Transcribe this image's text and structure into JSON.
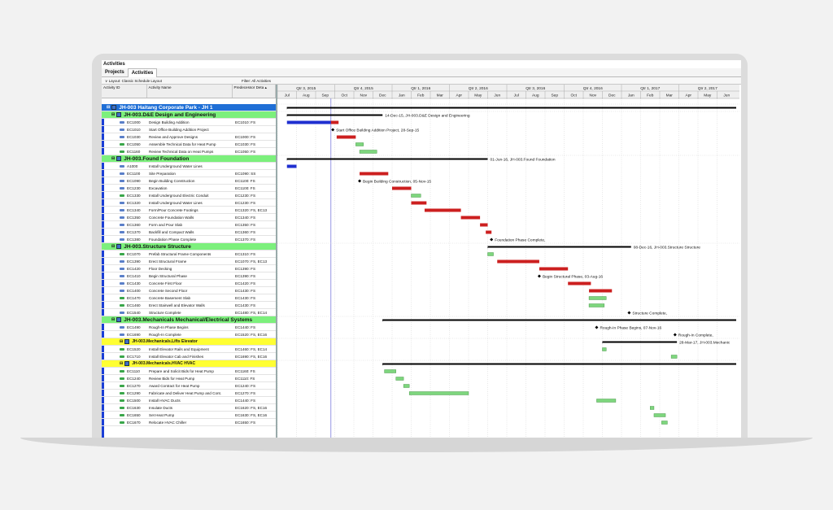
{
  "window": {
    "title": "Activities"
  },
  "tabs": [
    {
      "label": "Projects"
    },
    {
      "label": "Activities"
    }
  ],
  "toolbar": {
    "layout": "Layout: Classic Schedule Layout",
    "filter": "Filter: All Activities"
  },
  "columns": {
    "id": "Activity ID",
    "name": "Activity Name",
    "pred": "Predecessor Deta"
  },
  "timescale": {
    "quarters": [
      "Qtr 3, 2015",
      "Qtr 4, 2015",
      "Qtr 1, 2016",
      "Qtr 2, 2016",
      "Qtr 3, 2016",
      "Qtr 4, 2016",
      "Qtr 1, 2017",
      "Qtr 2, 2017"
    ],
    "months": [
      "Jul",
      "Aug",
      "Sep",
      "Oct",
      "Nov",
      "Dec",
      "Jan",
      "Feb",
      "Mar",
      "Apr",
      "May",
      "Jun",
      "Jul",
      "Aug",
      "Sep",
      "Oct",
      "Nov",
      "Dec",
      "Jan",
      "Feb",
      "Mar",
      "Apr",
      "May",
      "Jun"
    ]
  },
  "colors": {
    "wbs_project": "#1f6fd6",
    "wbs_green": "#7cf07c",
    "wbs_yellow": "#ffff33",
    "critical": "#cc1f1f",
    "normal": "#7ed67e",
    "progress": "#1f2fd0",
    "summary": "#000000"
  },
  "rows": [
    {
      "kind": "project",
      "name": "JH-003  Haitang Corporate Park - JH 1",
      "bar": {
        "type": "summary",
        "start": 0.5,
        "end": 24
      }
    },
    {
      "kind": "wbs",
      "color": "green",
      "name": "JH-003.D&E  Design and Engineering",
      "bar": {
        "type": "summary",
        "start": 0.5,
        "end": 5.5
      },
      "label": "14-Dec-15, JH-003.D&E  Design and Engineering"
    },
    {
      "kind": "act",
      "id": "EC1000",
      "name": "Design Building Addition",
      "pred": "EC1010: FS",
      "bar": {
        "type": "progress",
        "start": 0.5,
        "end": 2.8
      },
      "bar2": {
        "type": "critical",
        "start": 2.8,
        "end": 3.2
      }
    },
    {
      "kind": "act",
      "id": "EC1010",
      "name": "Start Office Building Addition Project",
      "pred": "",
      "bar": {
        "type": "milestone",
        "start": 2.9
      },
      "label": "Start Office Building Addition Project, 28-Sep-15"
    },
    {
      "kind": "act",
      "id": "EC1030",
      "name": "Review and Approve Designs",
      "pred": "EC1000: FS",
      "bar": {
        "type": "critical",
        "start": 3.1,
        "end": 4.1
      }
    },
    {
      "kind": "act",
      "id": "EC1050",
      "name": "Assemble Technical Data for Heat Pump",
      "pred": "EC1030: FS",
      "bar": {
        "type": "normal",
        "start": 4.1,
        "end": 4.5
      }
    },
    {
      "kind": "act",
      "id": "EC1160",
      "name": "Review Technical Data on Heat Pumps",
      "pred": "EC1050: FS",
      "bar": {
        "type": "normal",
        "start": 4.3,
        "end": 5.2
      }
    },
    {
      "kind": "wbs",
      "color": "green",
      "name": "JH-003.Found  Foundation",
      "bar": {
        "type": "summary",
        "start": 0.5,
        "end": 11.0
      },
      "label": "01-Jun-16, JH-003.Found  Foundation"
    },
    {
      "kind": "act",
      "id": "A1000",
      "name": "Install Underground Water Lines",
      "pred": "",
      "bar": {
        "type": "progress",
        "start": 0.5,
        "end": 1.0
      }
    },
    {
      "kind": "act",
      "id": "EC1100",
      "name": "Site Preparation",
      "pred": "EC1090: SS",
      "bar": {
        "type": "critical",
        "start": 4.3,
        "end": 5.8
      }
    },
    {
      "kind": "act",
      "id": "EC1090",
      "name": "Begin Building Construction",
      "pred": "EC1100: FS",
      "bar": {
        "type": "milestone",
        "start": 4.3
      },
      "label": "Begin Building Construction, 05-Nov-15"
    },
    {
      "kind": "act",
      "id": "EC1230",
      "name": "Excavation",
      "pred": "EC1100: FS",
      "bar": {
        "type": "critical",
        "start": 6.0,
        "end": 7.0
      }
    },
    {
      "kind": "act",
      "id": "EC1330",
      "name": "Install Underground Electric Conduit",
      "pred": "EC1230: FS",
      "bar": {
        "type": "normal",
        "start": 7.0,
        "end": 7.5
      }
    },
    {
      "kind": "act",
      "id": "EC1320",
      "name": "Install Underground Water Lines",
      "pred": "EC1230: FS",
      "bar": {
        "type": "critical",
        "start": 7.0,
        "end": 7.8
      }
    },
    {
      "kind": "act",
      "id": "EC1340",
      "name": "Form/Pour Concrete Footings",
      "pred": "EC1320: FS, EC13",
      "bar": {
        "type": "critical",
        "start": 7.7,
        "end": 9.6
      }
    },
    {
      "kind": "act",
      "id": "EC1350",
      "name": "Concrete Foundation Walls",
      "pred": "EC1340: FS",
      "bar": {
        "type": "critical",
        "start": 9.6,
        "end": 10.6
      }
    },
    {
      "kind": "act",
      "id": "EC1360",
      "name": "Form and Pour Slab",
      "pred": "EC1350: FS",
      "bar": {
        "type": "critical",
        "start": 10.6,
        "end": 11.0
      }
    },
    {
      "kind": "act",
      "id": "EC1370",
      "name": "Backfill and Compact Walls",
      "pred": "EC1360: FS",
      "bar": {
        "type": "critical",
        "start": 10.9,
        "end": 11.2
      }
    },
    {
      "kind": "act",
      "id": "EC1380",
      "name": "Foundation Phase Complete",
      "pred": "EC1370: FS",
      "bar": {
        "type": "milestone",
        "start": 11.2
      },
      "label": "Foundation Phase Complete,"
    },
    {
      "kind": "wbs",
      "color": "green",
      "name": "JH-003.Structure  Structure",
      "bar": {
        "type": "summary",
        "start": 11.0,
        "end": 18.5
      },
      "label": "08-Dec-16, JH-003.Structure  Structure"
    },
    {
      "kind": "act",
      "id": "EC1070",
      "name": "Prefab Structural Frame Components",
      "pred": "EC1310: FS",
      "bar": {
        "type": "normal",
        "start": 11.0,
        "end": 11.3
      }
    },
    {
      "kind": "act",
      "id": "EC1390",
      "name": "Erect Structural Frame",
      "pred": "EC1070: FS, EC13",
      "bar": {
        "type": "critical",
        "start": 11.5,
        "end": 13.7
      }
    },
    {
      "kind": "act",
      "id": "EC1420",
      "name": "Floor Decking",
      "pred": "EC1390: FS",
      "bar": {
        "type": "critical",
        "start": 13.7,
        "end": 15.2
      }
    },
    {
      "kind": "act",
      "id": "EC1410",
      "name": "Begin Structural Phase",
      "pred": "EC1390: FS",
      "bar": {
        "type": "milestone",
        "start": 13.7
      },
      "label": "Begin Structural Phase, 03-Aug-16"
    },
    {
      "kind": "act",
      "id": "EC1430",
      "name": "Concrete First Floor",
      "pred": "EC1420: FS",
      "bar": {
        "type": "critical",
        "start": 15.2,
        "end": 16.4
      }
    },
    {
      "kind": "act",
      "id": "EC1400",
      "name": "Concrete Second Floor",
      "pred": "EC1430: FS",
      "bar": {
        "type": "critical",
        "start": 16.3,
        "end": 17.5
      }
    },
    {
      "kind": "act",
      "id": "EC1470",
      "name": "Concrete Basement Slab",
      "pred": "EC1430: FS",
      "bar": {
        "type": "normal",
        "start": 16.3,
        "end": 17.2
      }
    },
    {
      "kind": "act",
      "id": "EC1460",
      "name": "Erect Stairwell and Elevator Walls",
      "pred": "EC1430: FS",
      "bar": {
        "type": "normal",
        "start": 16.3,
        "end": 17.1
      }
    },
    {
      "kind": "act",
      "id": "EC1540",
      "name": "Structure Complete",
      "pred": "EC1480: FS, EC14",
      "bar": {
        "type": "milestone",
        "start": 18.4
      },
      "label": "Structure Complete,"
    },
    {
      "kind": "wbs",
      "color": "green",
      "name": "JH-003.Mechanicals  Mechanical/Electrical Systems",
      "bar": {
        "type": "summary",
        "start": 5.5,
        "end": 24
      }
    },
    {
      "kind": "act",
      "id": "EC1490",
      "name": "Rough-In Phase Begins",
      "pred": "EC1440: FS",
      "bar": {
        "type": "milestone",
        "start": 16.7
      },
      "label": "Rough-In Phase Begins, 07-Nov-16"
    },
    {
      "kind": "act",
      "id": "EC1690",
      "name": "Rough-In Complete",
      "pred": "EC1520: FS, EC16",
      "bar": {
        "type": "milestone",
        "start": 20.8
      },
      "label": "Rough-In Complete,"
    },
    {
      "kind": "wbs",
      "color": "yellow",
      "name": "JH-003.Mechanicals.Lifts  Elevator",
      "bar": {
        "type": "summary",
        "start": 17.0,
        "end": 20.9
      },
      "label": "28-Mar-17, JH-003.Mechanic"
    },
    {
      "kind": "act",
      "id": "EC1520",
      "name": "Install Elevator Rails and Equipment",
      "pred": "EC1460: FS, EC14",
      "bar": {
        "type": "normal",
        "start": 17.0,
        "end": 17.2
      }
    },
    {
      "kind": "act",
      "id": "EC1710",
      "name": "Install Elevator Cab and Finishes",
      "pred": "EC1690: FS, EC16",
      "bar": {
        "type": "normal",
        "start": 20.6,
        "end": 20.9
      }
    },
    {
      "kind": "wbs",
      "color": "yellow",
      "name": "JH-003.Mechanicals.HVAC  HVAC",
      "bar": {
        "type": "summary",
        "start": 5.5,
        "end": 24
      }
    },
    {
      "kind": "act",
      "id": "EC1110",
      "name": "Prepare and Solicit Bids for Heat Pump",
      "pred": "EC1160: FS",
      "bar": {
        "type": "normal",
        "start": 5.6,
        "end": 6.2
      }
    },
    {
      "kind": "act",
      "id": "EC1240",
      "name": "Review Bids for Heat Pump",
      "pred": "EC1110: FS",
      "bar": {
        "type": "normal",
        "start": 6.2,
        "end": 6.6
      }
    },
    {
      "kind": "act",
      "id": "EC1270",
      "name": "Award Contract for Heat Pump",
      "pred": "EC1240: FS",
      "bar": {
        "type": "normal",
        "start": 6.6,
        "end": 6.9
      }
    },
    {
      "kind": "act",
      "id": "EC1290",
      "name": "Fabricate and Deliver Heat Pump and Cont.",
      "pred": "EC1270: FS",
      "bar": {
        "type": "normal",
        "start": 6.9,
        "end": 10.0
      }
    },
    {
      "kind": "act",
      "id": "EC1500",
      "name": "Install HVAC Ducts",
      "pred": "EC1440: FS",
      "bar": {
        "type": "normal",
        "start": 16.7,
        "end": 17.7
      }
    },
    {
      "kind": "act",
      "id": "EC1630",
      "name": "Insulate Ducts",
      "pred": "EC1620: FS, EC16",
      "bar": {
        "type": "normal",
        "start": 19.5,
        "end": 19.7
      }
    },
    {
      "kind": "act",
      "id": "EC1650",
      "name": "Set Heat Pump",
      "pred": "EC1630: FS, EC16",
      "bar": {
        "type": "normal",
        "start": 19.7,
        "end": 20.3
      }
    },
    {
      "kind": "act",
      "id": "EC1670",
      "name": "Relocate HVAC Chiller",
      "pred": "EC1650: FS",
      "bar": {
        "type": "normal",
        "start": 20.1,
        "end": 20.4
      }
    }
  ]
}
